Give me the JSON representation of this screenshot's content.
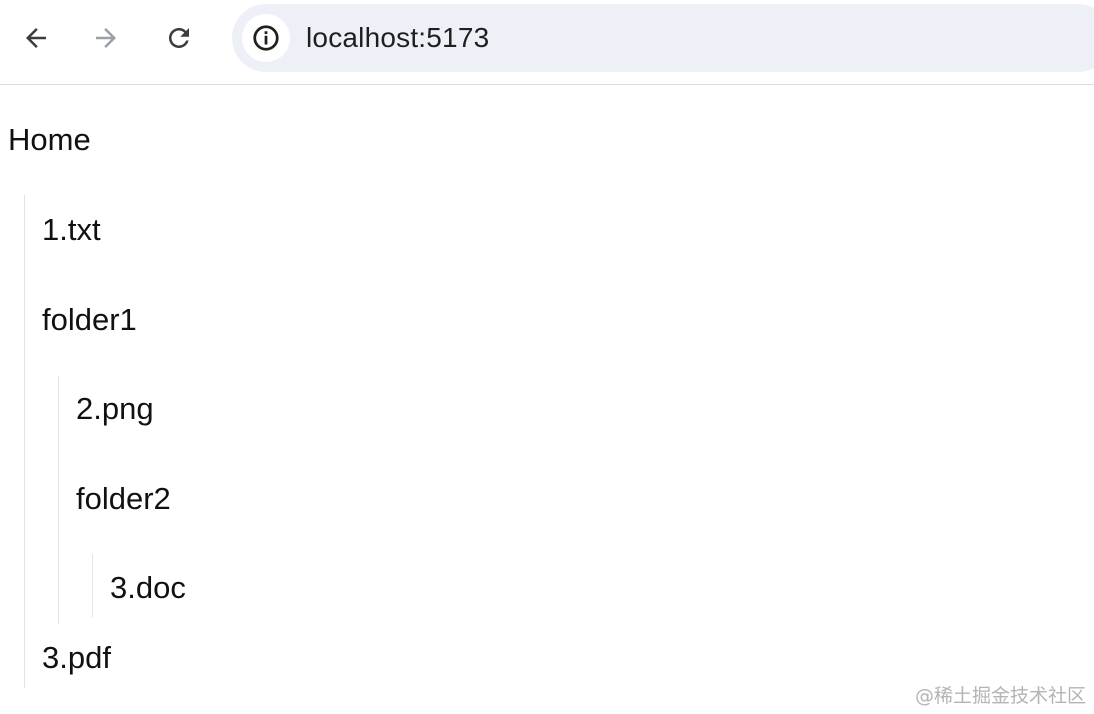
{
  "browser": {
    "url": "localhost:5173"
  },
  "tree": {
    "root_label": "Home",
    "level1": {
      "file1": "1.txt",
      "folder1": "folder1",
      "file3pdf": "3.pdf"
    },
    "level2": {
      "file2": "2.png",
      "folder2": "folder2"
    },
    "level3": {
      "file3doc": "3.doc"
    }
  },
  "watermark": "@稀土掘金技术社区",
  "icons": {
    "back": "arrow-left-icon",
    "forward": "arrow-right-icon",
    "reload": "reload-icon",
    "site_info": "info-icon"
  },
  "colors": {
    "omnibox_bg": "#eef0f7",
    "disabled_icon": "#9aa0a6",
    "active_icon": "#3c3c3c",
    "guide_line": "#e2e2e2"
  }
}
